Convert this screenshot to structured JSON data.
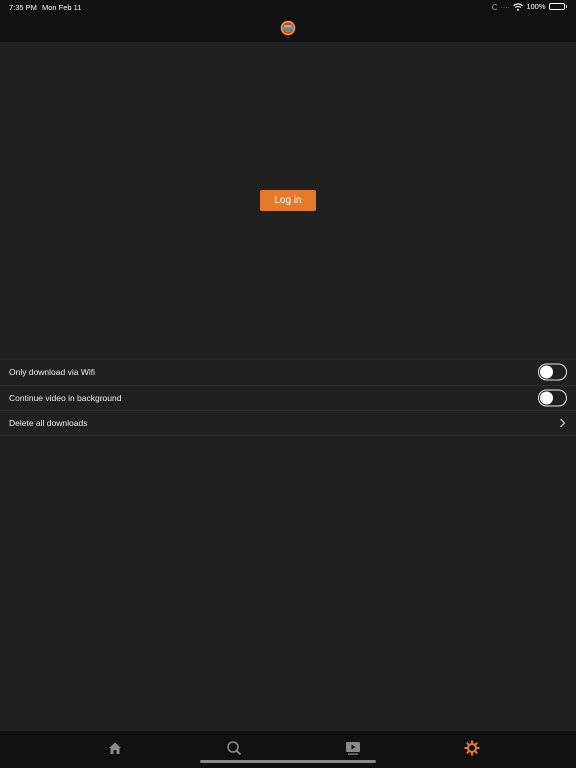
{
  "status_bar": {
    "time": "7:35 PM",
    "date": "Mon Feb 11",
    "signal_dots": "....",
    "battery_percent": "100%"
  },
  "main": {
    "login_label": "Log in"
  },
  "settings": {
    "items": [
      {
        "label": "Only download via Wifi",
        "control": "toggle",
        "on": false
      },
      {
        "label": "Continue video in background",
        "control": "toggle",
        "on": false
      },
      {
        "label": "Delete all downloads",
        "control": "chevron"
      }
    ]
  },
  "tabbar": {
    "tabs": [
      {
        "icon": "home-icon",
        "active": false
      },
      {
        "icon": "search-icon",
        "active": false
      },
      {
        "icon": "video-icon",
        "active": false
      },
      {
        "icon": "settings-gear-icon",
        "active": true
      }
    ],
    "active_color": "#e57a2a",
    "inactive_color": "#8a8a8a"
  },
  "colors": {
    "accent": "#e57a2a",
    "background": "#202020",
    "bar_background": "#111111"
  }
}
